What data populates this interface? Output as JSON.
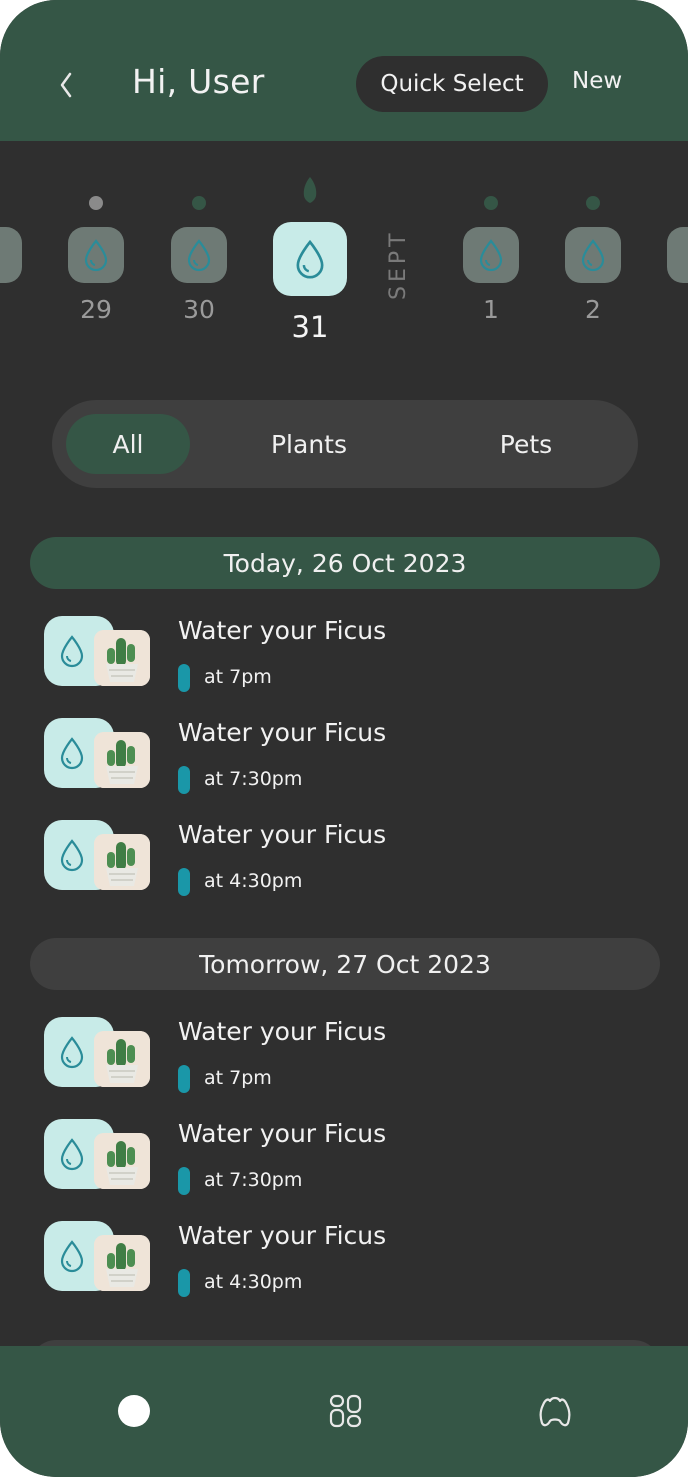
{
  "header": {
    "greeting": "Hi, User",
    "quick_select_label": "Quick Select",
    "new_label": "New"
  },
  "date_strip": {
    "month_label": "SEPT",
    "days": [
      {
        "num": "29"
      },
      {
        "num": "30"
      },
      {
        "num": "31",
        "selected": true
      },
      {
        "num": "1"
      },
      {
        "num": "2"
      }
    ]
  },
  "filters": {
    "tabs": [
      {
        "label": "All",
        "active": true
      },
      {
        "label": "Plants"
      },
      {
        "label": "Pets"
      }
    ]
  },
  "sections": [
    {
      "title": "Today, 26 Oct 2023",
      "tasks": [
        {
          "title": "Water your Ficus",
          "time": "at 7pm"
        },
        {
          "title": "Water your Ficus",
          "time": "at 7:30pm"
        },
        {
          "title": "Water your Ficus",
          "time": "at 4:30pm"
        }
      ]
    },
    {
      "title": "Tomorrow, 27 Oct 2023",
      "tasks": [
        {
          "title": "Water your Ficus",
          "time": "at 7pm"
        },
        {
          "title": "Water your Ficus",
          "time": "at 7:30pm"
        },
        {
          "title": "Water your Ficus",
          "time": "at 4:30pm"
        }
      ]
    }
  ],
  "colors": {
    "background": "#2f2f2f",
    "header": "#355646",
    "tile_active": "#c8ebe8",
    "tile_inactive": "#6e7a75",
    "accent_teal": "#1a97a8",
    "drop_icon": "#2a8c99"
  },
  "bottom_nav": {
    "items": [
      {
        "icon": "home-dot-icon"
      },
      {
        "icon": "categories-icon"
      },
      {
        "icon": "pet-icon"
      }
    ]
  }
}
